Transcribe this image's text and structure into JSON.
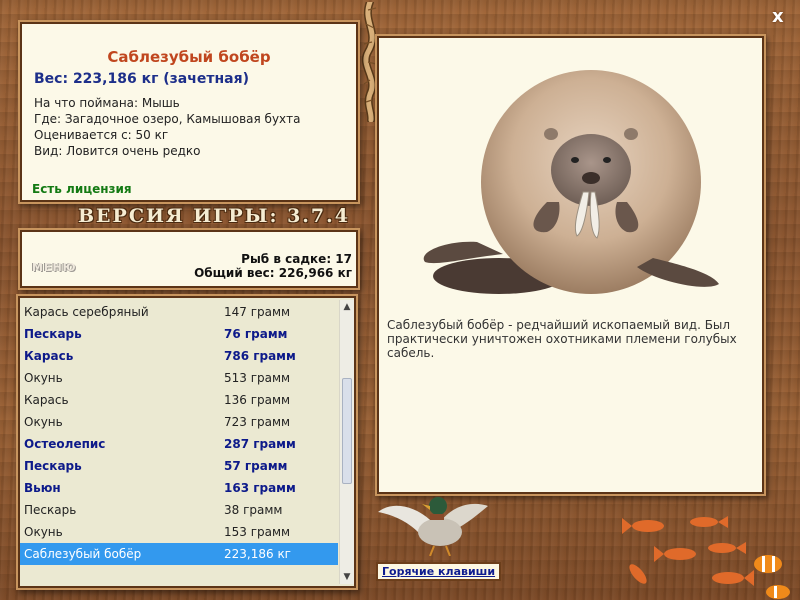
{
  "info": {
    "title": "Саблезубый бобёр",
    "weight": "Вес: 223,186 кг (зачетная)",
    "bait": "На что поймана: Мышь",
    "location": "Где: Загадочное озеро, Камышовая бухта",
    "price": "Оценивается с: 50 кг",
    "rarity": "Вид: Ловится очень редко",
    "license": "Есть лицензия"
  },
  "version": "ВЕРСИЯ ИГРЫ: 3.7.4",
  "stats": {
    "menu": "МЕНЮ",
    "fish_in_keepnet": "Рыб в садке: 17",
    "total_weight": "Общий вес: 226,966 кг"
  },
  "catch_list": [
    {
      "name": "Карась серебряный",
      "weight": "147 грамм",
      "bold": false
    },
    {
      "name": "Пескарь",
      "weight": "76 грамм",
      "bold": true
    },
    {
      "name": "Карась",
      "weight": "786 грамм",
      "bold": true
    },
    {
      "name": "Окунь",
      "weight": "513 грамм",
      "bold": false
    },
    {
      "name": "Карась",
      "weight": "136 грамм",
      "bold": false
    },
    {
      "name": "Окунь",
      "weight": "723 грамм",
      "bold": false
    },
    {
      "name": "Остеолепис",
      "weight": "287 грамм",
      "bold": true
    },
    {
      "name": "Пескарь",
      "weight": "57 грамм",
      "bold": true
    },
    {
      "name": "Вьюн",
      "weight": "163 грамм",
      "bold": true
    },
    {
      "name": "Пескарь",
      "weight": "38 грамм",
      "bold": false
    },
    {
      "name": "Окунь",
      "weight": "153 грамм",
      "bold": false
    },
    {
      "name": "Саблезубый бобёр",
      "weight": "223,186 кг",
      "bold": false,
      "selected": true
    }
  ],
  "description": "Саблезубый бобёр - редчайший ископаемый вид. Был практически уничтожен охотниками племени голубых сабель.",
  "hotkeys": "Горячие клавиши",
  "close": "x",
  "icons": {
    "close": "close-icon",
    "scroll_up": "arrow-up-icon",
    "scroll_down": "arrow-down-icon",
    "photo": "beaver-photo",
    "decor_bird": "duck-icon",
    "decor_fish": "fish-icon",
    "decor_bait": "worm-icon"
  },
  "colors": {
    "title": "#c0461e",
    "weight": "#1d2f8a",
    "license": "#137a13",
    "bold_row": "#0d1a8a",
    "selected_row": "#3399ee",
    "panel": "#fcf9e8",
    "wood": "#8c5630"
  }
}
